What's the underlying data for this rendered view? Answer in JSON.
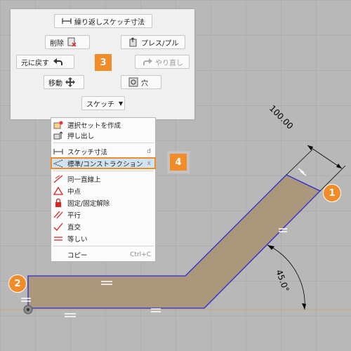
{
  "toolbar": {
    "repeat_dim_label": "繰り返しスケッチ寸法",
    "delete_label": "削除",
    "press_pull_label": "プレス/プル",
    "undo_label": "元に戻す",
    "redo_label": "やり直し",
    "move_label": "移動",
    "hole_label": "穴",
    "sketch_label": "スケッチ"
  },
  "badges": {
    "b3": "3",
    "b4": "4",
    "b1": "1",
    "b2": "2"
  },
  "context_menu": {
    "items": [
      {
        "label": "選択セットを作成",
        "shortcut": ""
      },
      {
        "label": "押し出し",
        "shortcut": ""
      },
      {
        "label": "スケッチ寸法",
        "shortcut": "d"
      },
      {
        "label": "標準/コンストラクション",
        "shortcut": "x"
      },
      {
        "label": "同一直線上",
        "shortcut": ""
      },
      {
        "label": "中点",
        "shortcut": ""
      },
      {
        "label": "固定/固定解除",
        "shortcut": ""
      },
      {
        "label": "平行",
        "shortcut": ""
      },
      {
        "label": "直交",
        "shortcut": ""
      },
      {
        "label": "等しい",
        "shortcut": ""
      },
      {
        "label": "コピー",
        "shortcut": "Ctrl+C"
      }
    ]
  },
  "dimensions": {
    "length": "100.00",
    "angle": "45.0°"
  },
  "colors": {
    "fill": "#a89170",
    "outline": "#2a2ad0",
    "badge": "#f28c28",
    "highlight": "#cfe3f5"
  }
}
